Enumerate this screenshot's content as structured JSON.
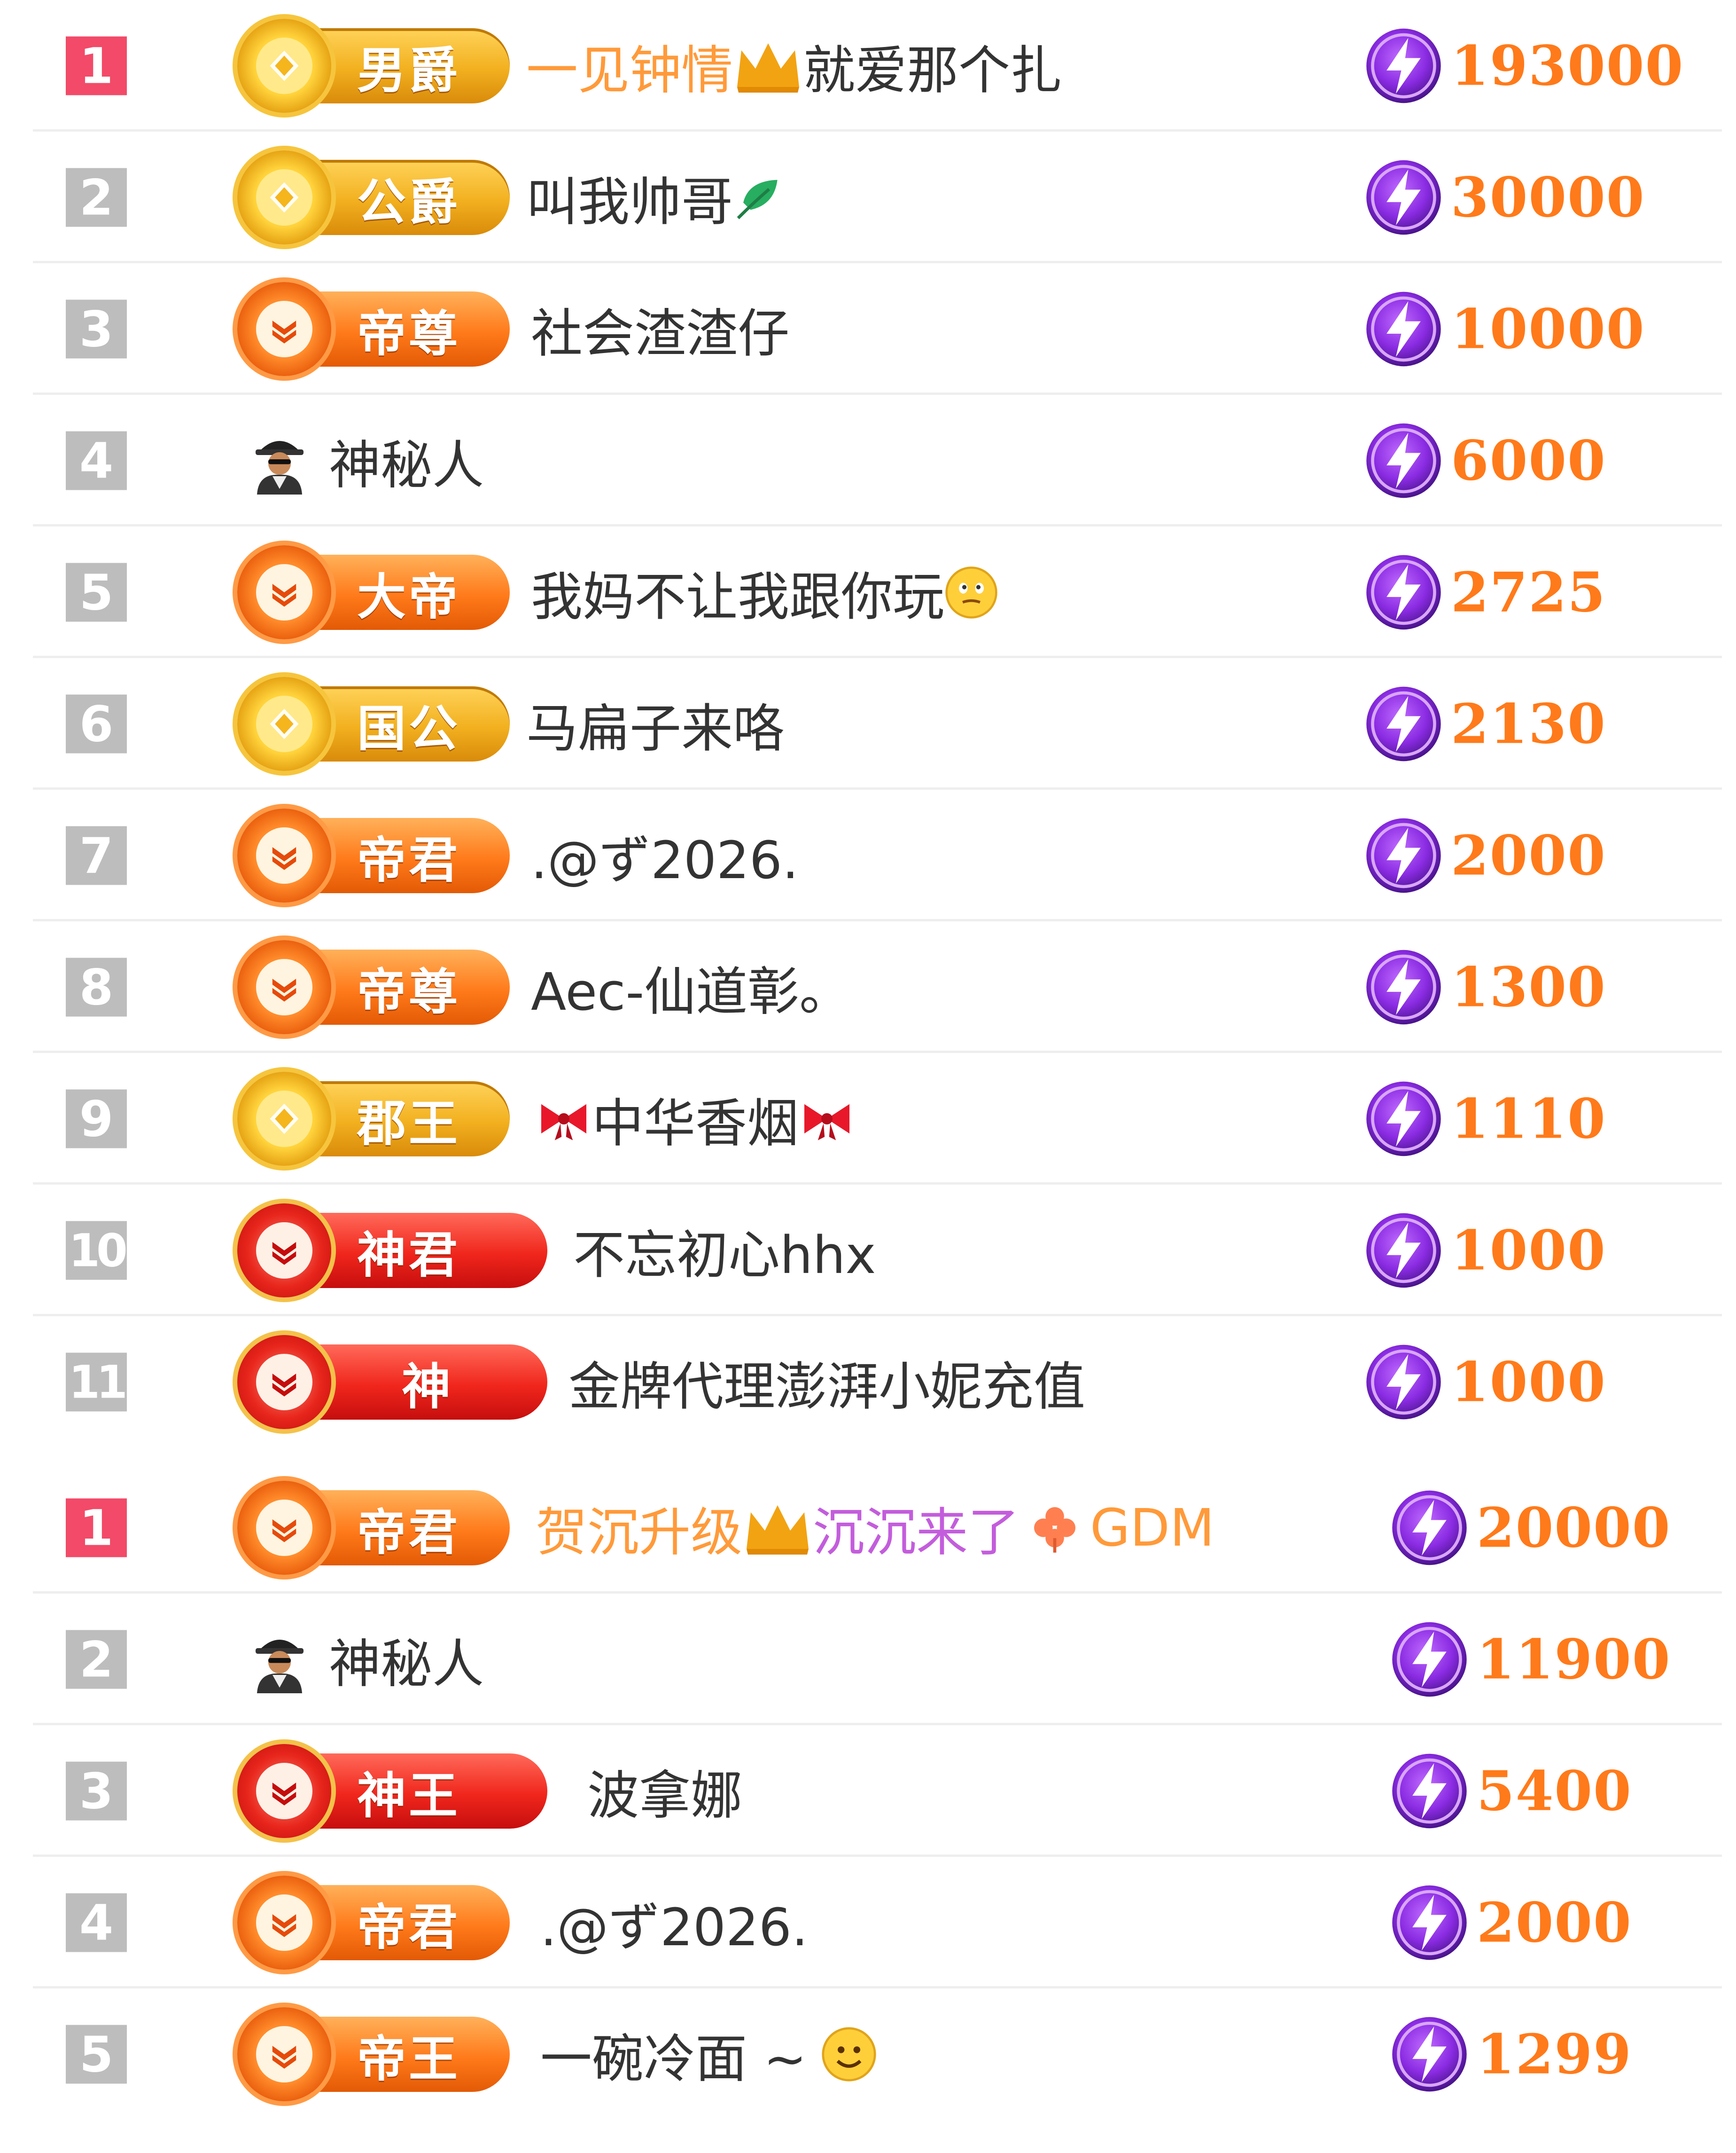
{
  "colors": {
    "rank_top": "#f24a68",
    "rank_other": "#bdbdbd",
    "score": "#ff7a1a",
    "name_default": "#333333",
    "name_orange": "#ff9a3a",
    "name_purple": "#c35ddc",
    "row_divider": "#eeeeee"
  },
  "list1": {
    "rows": [
      {
        "rank": "1",
        "badge": {
          "label": "男爵",
          "style": "gold",
          "icon": "gold-coin-icon"
        },
        "name_parts": [
          "一见钟情",
          "就爱那个扎"
        ],
        "score": "193000"
      },
      {
        "rank": "2",
        "badge": {
          "label": "公爵",
          "style": "gold",
          "icon": "gold-coin-icon"
        },
        "name_parts": [
          "叫我帅哥"
        ],
        "score": "30000"
      },
      {
        "rank": "3",
        "badge": {
          "label": "帝尊",
          "style": "orange",
          "icon": "orange-crest-icon"
        },
        "name_parts": [
          "社会渣渣仔"
        ],
        "score": "10000"
      },
      {
        "rank": "4",
        "badge": null,
        "icon": "mystery-person-icon",
        "name_parts": [
          "神秘人"
        ],
        "score": "6000"
      },
      {
        "rank": "5",
        "badge": {
          "label": "大帝",
          "style": "orange",
          "icon": "orange-crest-icon"
        },
        "name_parts": [
          "我妈不让我跟你玩"
        ],
        "score": "2725"
      },
      {
        "rank": "6",
        "badge": {
          "label": "国公",
          "style": "gold",
          "icon": "gold-coin-icon"
        },
        "name_parts": [
          "马扁子来咯"
        ],
        "score": "2130"
      },
      {
        "rank": "7",
        "badge": {
          "label": "帝君",
          "style": "orange",
          "icon": "orange-crest-icon"
        },
        "name_parts": [
          ".@ず2026."
        ],
        "score": "2000"
      },
      {
        "rank": "8",
        "badge": {
          "label": "帝尊",
          "style": "orange",
          "icon": "orange-crest-icon"
        },
        "name_parts": [
          "Aec-仙道彰。"
        ],
        "score": "1300"
      },
      {
        "rank": "9",
        "badge": {
          "label": "郡王",
          "style": "gold",
          "icon": "gold-coin-icon"
        },
        "name_parts": [
          "中华香烟"
        ],
        "score": "1110"
      },
      {
        "rank": "10",
        "badge": {
          "label": "神君",
          "style": "red",
          "icon": "red-crest-icon"
        },
        "name_parts": [
          "不忘初心hhx"
        ],
        "score": "1000"
      },
      {
        "rank": "11",
        "badge": {
          "label": "神",
          "style": "red",
          "icon": "red-crest-icon"
        },
        "name_parts": [
          "金牌代理澎湃小妮充值"
        ],
        "score": "1000"
      }
    ]
  },
  "list2": {
    "rows": [
      {
        "rank": "1",
        "badge": {
          "label": "帝君",
          "style": "orange",
          "icon": "orange-crest-icon"
        },
        "name_parts": [
          "贺沉升级",
          "沉沉来了",
          "GDM"
        ],
        "score": "20000"
      },
      {
        "rank": "2",
        "badge": null,
        "icon": "mystery-person-icon",
        "name_parts": [
          "神秘人"
        ],
        "score": "11900"
      },
      {
        "rank": "3",
        "badge": {
          "label": "神王",
          "style": "red",
          "icon": "red-crest-icon"
        },
        "name_parts": [
          "波拿娜"
        ],
        "score": "5400"
      },
      {
        "rank": "4",
        "badge": {
          "label": "帝君",
          "style": "orange",
          "icon": "orange-crest-icon"
        },
        "name_parts": [
          ".@ず2026."
        ],
        "score": "2000"
      },
      {
        "rank": "5",
        "badge": {
          "label": "帝王",
          "style": "orange",
          "icon": "orange-crest-icon"
        },
        "name_parts": [
          "一碗冷面 ~"
        ],
        "score": "1299"
      }
    ]
  }
}
